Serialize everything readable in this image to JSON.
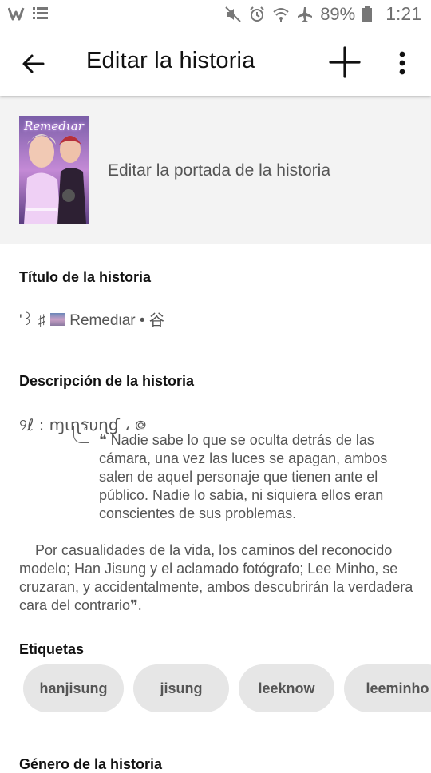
{
  "status_bar": {
    "app_icons": [
      "wattpad-icon",
      "list-icon"
    ],
    "battery_pct": "89%",
    "time": "1:21"
  },
  "app_bar": {
    "title": "Editar la historia"
  },
  "cover": {
    "edit_label": "Editar la portada de la historia",
    "image_text": "Remedιar"
  },
  "story_title": {
    "label": "Título de la historia",
    "value_prefix": "'꒱ ♯",
    "value_text": "Remedιar • 谷"
  },
  "description": {
    "label": "Descripción de la historia",
    "header": "୨ℓ : ɱιɳรυɳɠ ، ᪤",
    "paragraph1": "❝ Nadie sabe lo que se oculta detrás de las cámara, una vez las luces se apagan, ambos salen de aquel personaje que tienen ante el público. Nadie lo sabia, ni siquiera ellos eran conscientes de sus problemas.",
    "paragraph2": "Por casualidades de la vida, los caminos del reconocido modelo; Han Jisung y el aclamado fotógrafo; Lee Minho, se cruzaran, y accidentalmente, ambos descubrirán la verdadera cara del contrario❞."
  },
  "tags": {
    "label": "Etiquetas",
    "items": [
      "hanjisung",
      "jisung",
      "leeknow",
      "leeminho"
    ]
  },
  "genre": {
    "label": "Género de la historia"
  }
}
